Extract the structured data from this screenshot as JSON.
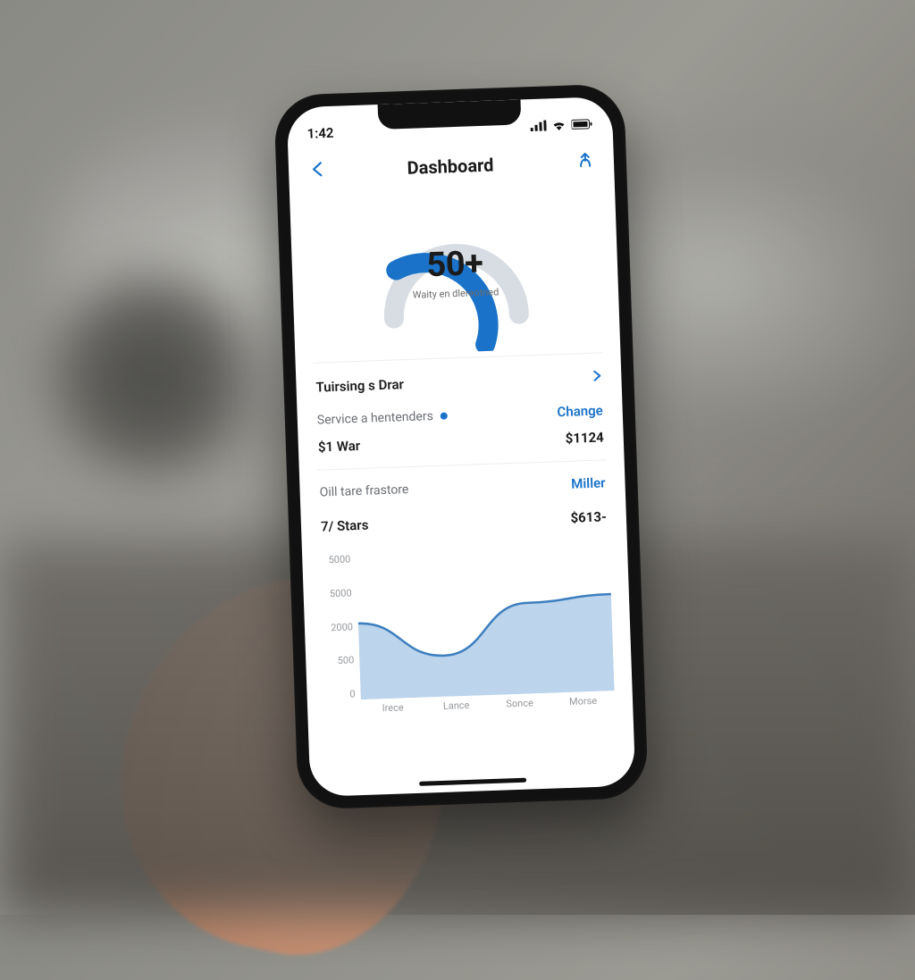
{
  "status": {
    "time": "1:42"
  },
  "nav": {
    "title": "Dashboard"
  },
  "gauge": {
    "value": "50+",
    "subtext": "Waity en dlereotned",
    "percent": 62
  },
  "rows": {
    "r1": {
      "label": "Tuirsing s Drar"
    },
    "r2": {
      "sub": "Service a hentenders",
      "link": "Change"
    },
    "r3": {
      "label": "$1 War",
      "value": "$1124"
    },
    "r4": {
      "sub": "Oill tare frastore",
      "link": "Miller"
    },
    "r5": {
      "label": "7/ Stars",
      "value": "$613-"
    }
  },
  "chart_data": {
    "type": "area",
    "categories": [
      "Irece",
      "Lance",
      "Sonce",
      "Morse"
    ],
    "values": [
      2600,
      1400,
      3100,
      3300
    ],
    "ylabel": "",
    "ylim": [
      0,
      5000
    ],
    "y_ticks": [
      "5000",
      "5000",
      "2000",
      "500",
      "0"
    ]
  },
  "colors": {
    "accent": "#1a73c9",
    "area_fill": "#bcd4ec",
    "area_stroke": "#3d7fbf"
  }
}
